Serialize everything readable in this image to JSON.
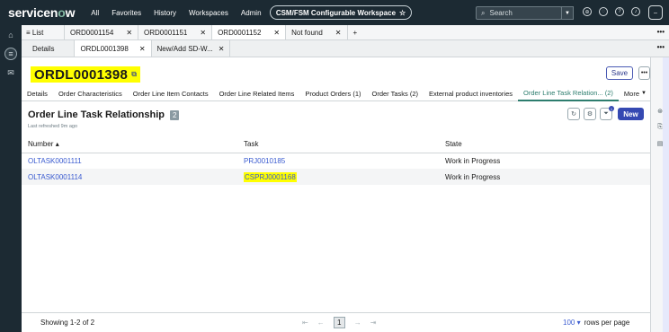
{
  "topbar": {
    "logo_a": "servicen",
    "logo_o": "o",
    "logo_b": "w",
    "nav": [
      "All",
      "Favorites",
      "History",
      "Workspaces",
      "Admin"
    ],
    "scope_label": "CSM/FSM Configurable Workspace",
    "scope_icon": "star-icon",
    "search_placeholder": "Search",
    "avatar": "–"
  },
  "tabs1": {
    "list_label": "List",
    "items": [
      {
        "label": "ORD0001154"
      },
      {
        "label": "ORD0001151"
      },
      {
        "label": "ORD0001152",
        "active": true
      },
      {
        "label": "Not found"
      }
    ],
    "more": "•••"
  },
  "tabs2": {
    "items": [
      {
        "label": "Details"
      },
      {
        "label": "ORDL0001398",
        "active": true
      },
      {
        "label": "New/Add SD-W..."
      }
    ],
    "more": "•••"
  },
  "record": {
    "number": "ORDL0001398",
    "save_label": "Save",
    "tabs": [
      {
        "label": "Details"
      },
      {
        "label": "Order Characteristics"
      },
      {
        "label": "Order Line Item Contacts"
      },
      {
        "label": "Order Line Related Items"
      },
      {
        "label": "Product Orders (1)"
      },
      {
        "label": "Order Tasks (2)"
      },
      {
        "label": "External product inventories"
      },
      {
        "label": "Order Line Task Relation...  (2)",
        "active": true
      },
      {
        "label": "More"
      }
    ]
  },
  "related_list": {
    "title": "Order Line Task Relationship",
    "count": "2",
    "refreshed": "Last refreshed 9m ago",
    "filter_count": "1",
    "new_label": "New",
    "columns": [
      "Number",
      "Task",
      "State"
    ],
    "rows": [
      {
        "number": "OLTASK0001111",
        "task": "PRJ0010185",
        "state": "Work in Progress"
      },
      {
        "number": "OLTASK0001114",
        "task": "CSPRJ0001168",
        "state": "Work in Progress"
      }
    ],
    "showing": "Showing 1-2 of 2",
    "page": "1",
    "rows_per_page_value": "100",
    "rows_per_page_label": "rows per page"
  },
  "colors": {
    "topbar": "#1c2a33",
    "highlight": "#ffff00",
    "primary": "#3549b2",
    "link": "#3a5bd0",
    "active_tab": "#2d7d6e"
  }
}
